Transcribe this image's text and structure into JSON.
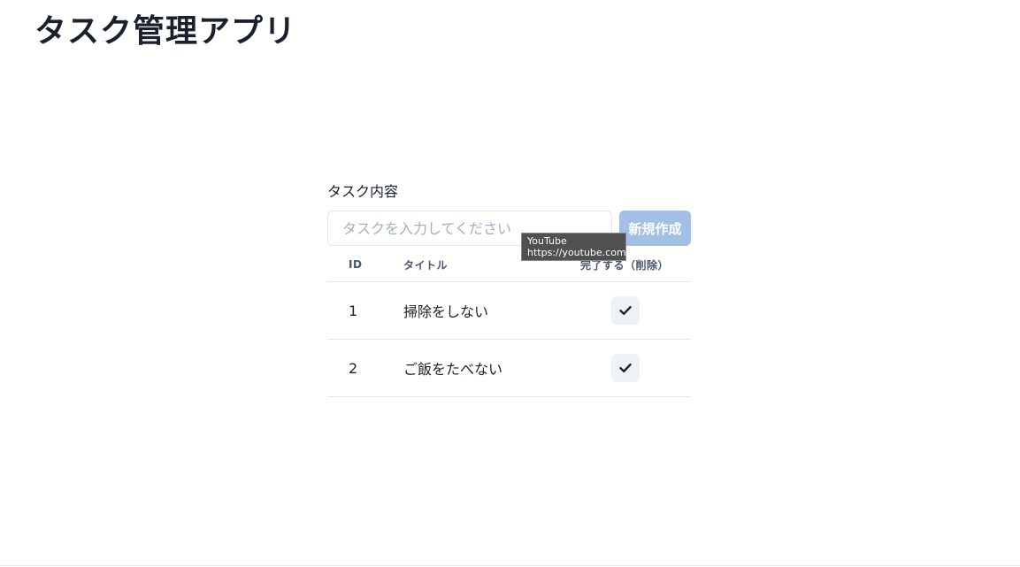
{
  "app": {
    "title": "タスク管理アプリ"
  },
  "form": {
    "label": "タスク内容",
    "input_value": "",
    "input_placeholder": "タスクを入力してください",
    "create_label": "新規作成"
  },
  "table": {
    "headers": {
      "id": "ID",
      "title": "タイトル",
      "done": "完了する（削除）"
    },
    "rows": [
      {
        "id": "1",
        "title": "掃除をしない",
        "action_icon": "check-icon"
      },
      {
        "id": "2",
        "title": "ご飯をたべない",
        "action_icon": "check-icon"
      }
    ]
  },
  "tooltip": {
    "line1": "YouTube",
    "line2": "https://youtube.com"
  },
  "colors": {
    "primary_button_disabled": "#a3bfe6",
    "text": "#1a202c",
    "icon_button_bg": "#edf2f7"
  }
}
